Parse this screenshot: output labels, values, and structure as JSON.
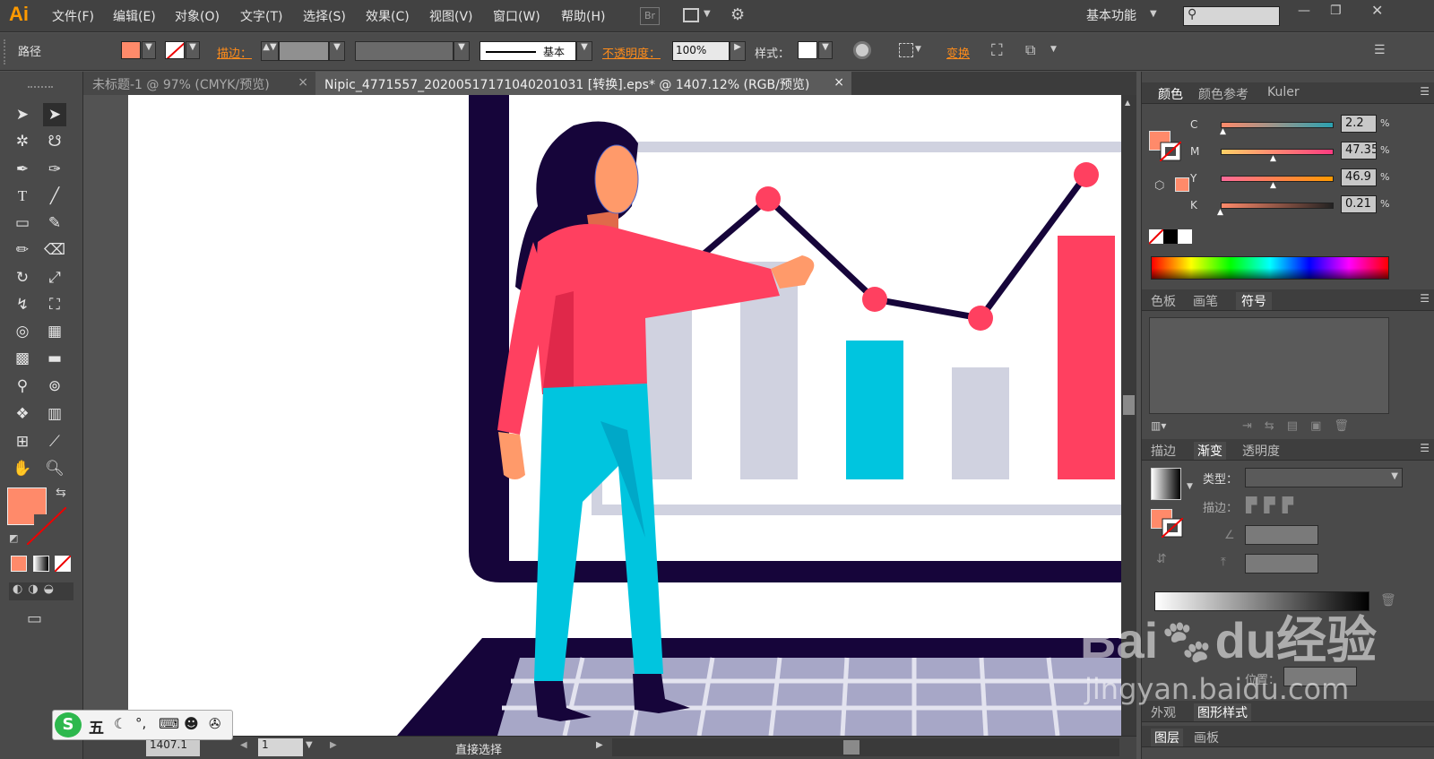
{
  "app": {
    "logo": "Ai"
  },
  "menu": [
    "文件(F)",
    "编辑(E)",
    "对象(O)",
    "文字(T)",
    "选择(S)",
    "效果(C)",
    "视图(V)",
    "窗口(W)",
    "帮助(H)"
  ],
  "menu_extra": {
    "br": "Br",
    "workspace": "基本功能"
  },
  "control": {
    "object_type": "路径",
    "stroke_label": "描边：",
    "stroke_style": "基本",
    "opacity_label": "不透明度：",
    "opacity_value": "100%",
    "style_label": "样式：",
    "transform_label": "变换"
  },
  "tabs": [
    {
      "label": "未标题-1 @ 97% (CMYK/预览)",
      "close": "×"
    },
    {
      "label": "Nipic_4771557_20200517171040201031 [转换].eps* @ 1407.12% (RGB/预览)",
      "close": "×"
    }
  ],
  "panels": {
    "color_tabs": [
      "颜色",
      "颜色参考",
      "Kuler"
    ],
    "cmyk": [
      {
        "label": "C",
        "value": "2.2",
        "unit": "%",
        "fraction": 0.02
      },
      {
        "label": "M",
        "value": "47.35",
        "unit": "%",
        "fraction": 0.47
      },
      {
        "label": "Y",
        "value": "46.9",
        "unit": "%",
        "fraction": 0.47
      },
      {
        "label": "K",
        "value": "0.21",
        "unit": "%",
        "fraction": 0.0
      }
    ],
    "swatch_tabs": [
      "色板",
      "画笔",
      "符号"
    ],
    "gradient_tabs": [
      "描边",
      "渐变",
      "透明度"
    ],
    "gradient": {
      "type_label": "类型：",
      "stroke_label": "描边：",
      "position_label": "位置："
    },
    "appearance_tabs": [
      "外观",
      "图形样式"
    ],
    "layer_tabs": [
      "图层",
      "画板"
    ]
  },
  "status": {
    "zoom": "1407.1",
    "page": "1",
    "tool": "直接选择"
  },
  "ime": {
    "label": "五"
  },
  "watermark": {
    "brand": "Bai",
    "brand2": "du",
    "cn": "经验",
    "url": "jingyan.baidu.com"
  },
  "colors": {
    "fill": "#ff8a6a",
    "accent": "#ff8c1a",
    "dark": "#16053a",
    "pink": "#ff4060",
    "cyan": "#00c5df",
    "grey": "#d0d2e0"
  }
}
